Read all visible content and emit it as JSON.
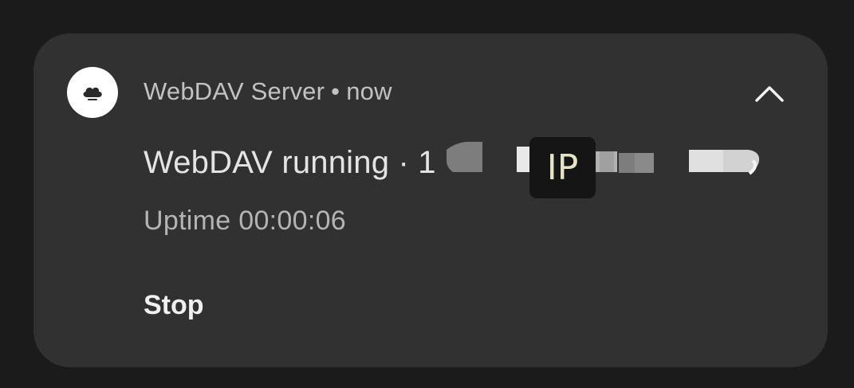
{
  "notification": {
    "app_name": "WebDAV Server",
    "separator": "•",
    "time": "now",
    "app_icon": "cloud-icon",
    "expand_icon": "chevron-up-icon",
    "title_prefix": "WebDAV running · 1",
    "redaction_badge": "IP",
    "uptime_text": "Uptime 00:00:06",
    "actions": [
      {
        "label": "Stop"
      }
    ]
  },
  "colors": {
    "background": "#1b1b1b",
    "card": "#313131",
    "icon_background": "#ffffff",
    "badge_background": "#151515",
    "badge_text": "#e7e3c6"
  }
}
